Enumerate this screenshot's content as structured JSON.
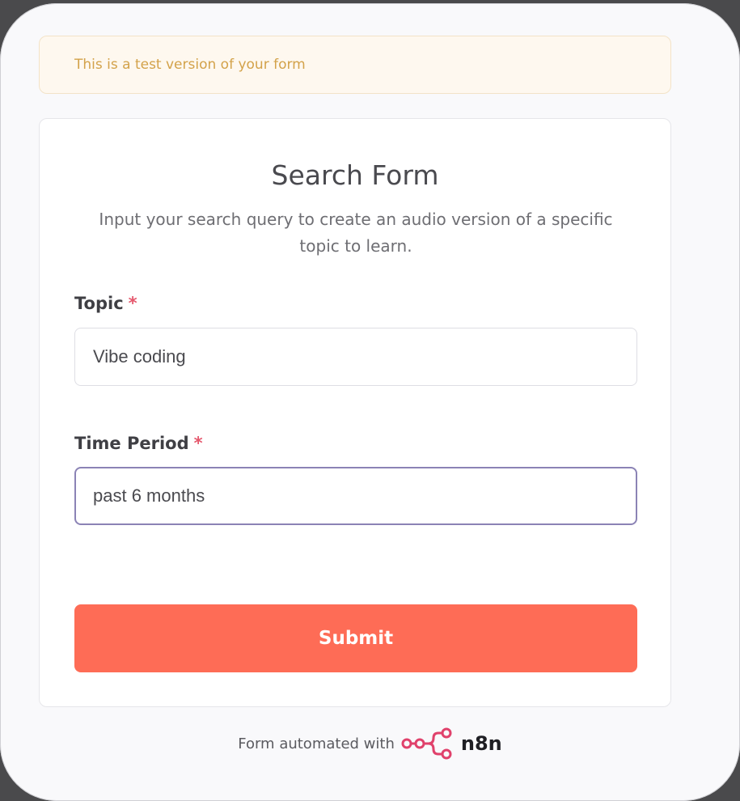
{
  "banner": {
    "text": "This is a test version of your form"
  },
  "form": {
    "title": "Search Form",
    "description": "Input your search query to create an audio version of a specific topic to learn.",
    "fields": [
      {
        "label": "Topic",
        "required_mark": "*",
        "value": "Vibe coding"
      },
      {
        "label": "Time Period",
        "required_mark": "*",
        "value": "past 6 months"
      }
    ],
    "submit_label": "Submit"
  },
  "footer": {
    "text": "Form automated with",
    "logo_text": "n8n",
    "logo_icon": "n8n-logo-icon"
  },
  "colors": {
    "accent": "#fe6c56",
    "required": "#e5586d",
    "banner_text": "#d3a24a",
    "focus_border": "#8b83b5",
    "logo_mark": "#e0416b"
  }
}
